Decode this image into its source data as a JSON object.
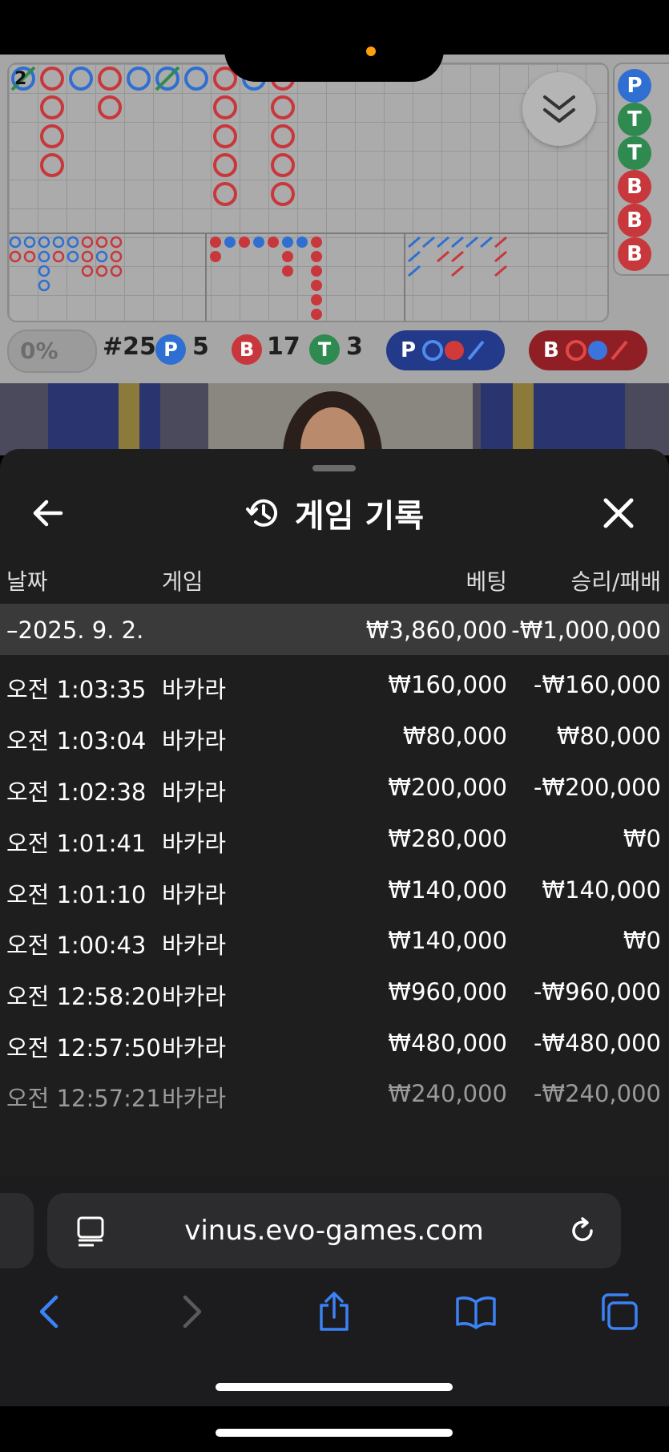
{
  "board": {
    "big_road_top_label": "2",
    "counter_toggle": "0%",
    "round_label": "#25",
    "player_letter": "P",
    "player_count": "5",
    "banker_letter": "B",
    "banker_count": "17",
    "tie_letter": "T",
    "tie_count": "3",
    "pred_player_letter": "P",
    "pred_banker_letter": "B",
    "side_column": [
      "P",
      "T",
      "T",
      "B",
      "B",
      "B"
    ]
  },
  "history": {
    "title": "게임 기록",
    "columns": {
      "date": "날짜",
      "game": "게임",
      "bet": "베팅",
      "result": "승리/패배"
    },
    "date_summary": {
      "date": "–2025. 9. 2.",
      "bet": "₩3,860,000",
      "result": "-₩1,000,000"
    },
    "rows": [
      {
        "time": "오전 1:03:35",
        "game": "바카라",
        "bet": "₩160,000",
        "result": "-₩160,000"
      },
      {
        "time": "오전 1:03:04",
        "game": "바카라",
        "bet": "₩80,000",
        "result": "₩80,000"
      },
      {
        "time": "오전 1:02:38",
        "game": "바카라",
        "bet": "₩200,000",
        "result": "-₩200,000"
      },
      {
        "time": "오전 1:01:41",
        "game": "바카라",
        "bet": "₩280,000",
        "result": "₩0"
      },
      {
        "time": "오전 1:01:10",
        "game": "바카라",
        "bet": "₩140,000",
        "result": "₩140,000"
      },
      {
        "time": "오전 1:00:43",
        "game": "바카라",
        "bet": "₩140,000",
        "result": "₩0"
      },
      {
        "time": "오전 12:58:20",
        "game": "바카라",
        "bet": "₩960,000",
        "result": "-₩960,000"
      },
      {
        "time": "오전 12:57:50",
        "game": "바카라",
        "bet": "₩480,000",
        "result": "-₩480,000"
      },
      {
        "time": "오전 12:57:21",
        "game": "바카라",
        "bet": "₩240,000",
        "result": "-₩240,000"
      }
    ]
  },
  "browser": {
    "url": "vinus.evo-games.com"
  },
  "colors": {
    "player": "#2f6fd1",
    "banker": "#c8373b",
    "tie": "#2e8a4f"
  }
}
